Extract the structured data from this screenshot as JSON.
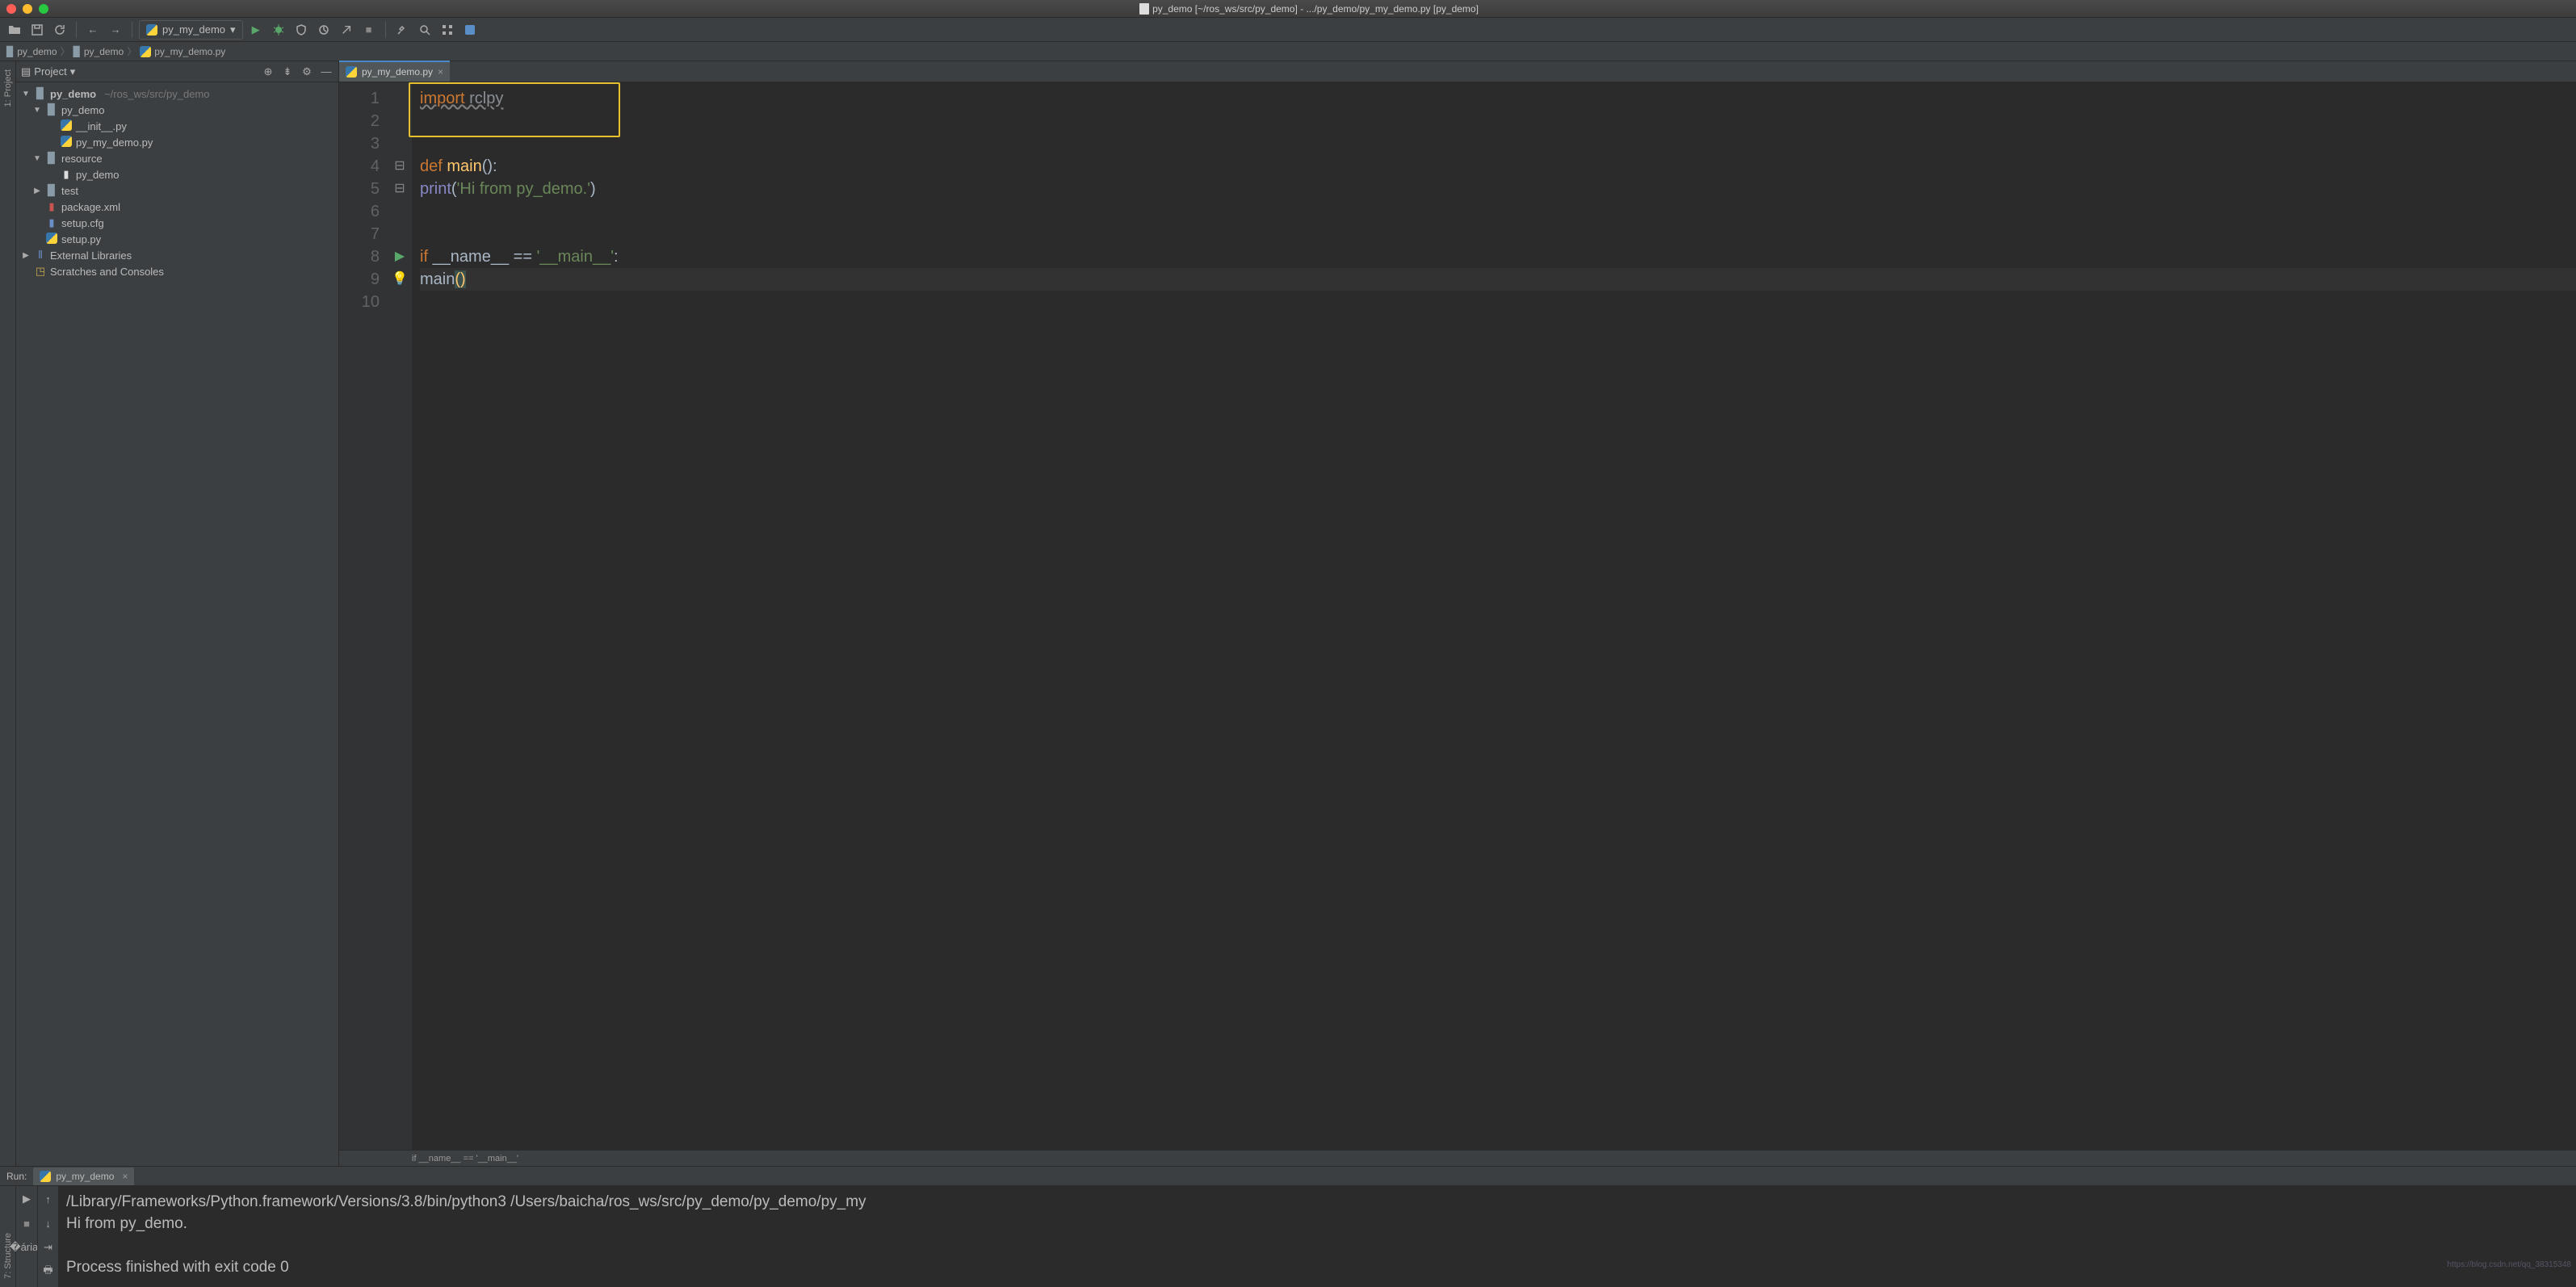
{
  "titlebar": "py_demo [~/ros_ws/src/py_demo] - .../py_demo/py_my_demo.py [py_demo]",
  "run_config": "py_my_demo",
  "breadcrumb": {
    "root": "py_demo",
    "folder": "py_demo",
    "file": "py_my_demo.py"
  },
  "sidebar": {
    "title": "Project",
    "root_name": "py_demo",
    "root_path": "~/ros_ws/src/py_demo",
    "pkg_folder": "py_demo",
    "init_py": "__init__.py",
    "my_demo_py": "py_my_demo.py",
    "resource": "resource",
    "resource_file": "py_demo",
    "test": "test",
    "package_xml": "package.xml",
    "setup_cfg": "setup.cfg",
    "setup_py": "setup.py",
    "external_libs": "External Libraries",
    "scratches": "Scratches and Consoles"
  },
  "leftrail": {
    "project": "1: Project",
    "structure": "7: Structure"
  },
  "tab": "py_my_demo.py",
  "code": {
    "l1a": "import",
    "l1b": " rclpy",
    "l4a": "def ",
    "l4b": "main",
    "l4c": "():",
    "l5a": "    print",
    "l5b": "(",
    "l5c": "'Hi from py_demo.'",
    "l5d": ")",
    "l8a": "if ",
    "l8b": "__name__ ",
    "l8c": "== ",
    "l8d": "'__main__'",
    "l8e": ":",
    "l9a": "    main",
    "l9b": "(",
    "l9c": ")"
  },
  "crumb_bar": "if __name__ == '__main__'",
  "gutter": [
    "1",
    "2",
    "3",
    "4",
    "5",
    "6",
    "7",
    "8",
    "9",
    "10"
  ],
  "run": {
    "title": "Run:",
    "tab": "py_my_demo",
    "line1": "/Library/Frameworks/Python.framework/Versions/3.8/bin/python3 /Users/baicha/ros_ws/src/py_demo/py_demo/py_my",
    "line2": "Hi from py_demo.",
    "line3": "",
    "line4": "Process finished with exit code 0"
  },
  "watermark": "https://blog.csdn.net/qq_38315348"
}
